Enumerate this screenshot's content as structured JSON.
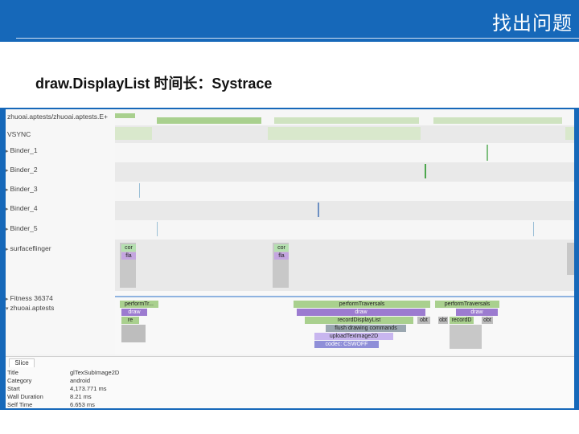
{
  "slide": {
    "title": "找出问题",
    "subtitle": "draw.DisplayList 时间长：Systrace",
    "accent": "#1668b9"
  },
  "threads": [
    {
      "label": "zhuoai.aptests/zhuoai.aptests.E+",
      "arrow": ""
    },
    {
      "label": "VSYNC",
      "arrow": ""
    },
    {
      "label": "Binder_1",
      "arrow": "▸"
    },
    {
      "label": "Binder_2",
      "arrow": "▸"
    },
    {
      "label": "Binder_3",
      "arrow": "▸"
    },
    {
      "label": "Binder_4",
      "arrow": "▸"
    },
    {
      "label": "Binder_5",
      "arrow": "▸"
    },
    {
      "label": "surfaceflinger",
      "arrow": "▸"
    },
    {
      "label": "Fitness 36374",
      "arrow": "▸"
    },
    {
      "label": "zhuoai.aptests",
      "arrow": "▾"
    }
  ],
  "slices": {
    "sf_a1": "cor",
    "sf_a2": "fla",
    "sf_b1": "cor",
    "sf_b2": "fla",
    "perf1": "performTr...",
    "draw1": "draw",
    "rec1": "re",
    "perf2": "performTraversals",
    "draw2": "draw",
    "rec2": "recordDisplayList",
    "flush": "flush drawing commands",
    "upload": "uploadTexImage2D",
    "texsub": "codec: CSWOFF",
    "obt1": "obt",
    "perf3": "performTraversals",
    "draw3": "draw",
    "rec3": "recordD",
    "obt2": "obt",
    "obt3": "obt"
  },
  "details": {
    "tab": "Slice",
    "rows": [
      {
        "key": "Title",
        "value": "glTexSubImage2D"
      },
      {
        "key": "Category",
        "value": "android"
      },
      {
        "key": "Start",
        "value": "4,173.771 ms"
      },
      {
        "key": "Wall Duration",
        "value": "8.21 ms"
      },
      {
        "key": "Self Time",
        "value": "6.653 ms"
      }
    ]
  },
  "colors": {
    "green": "#a9d08e",
    "purple": "#9c7bd0",
    "lavender": "#c8b6ef",
    "grey": "#c8c8c8",
    "blue": "#7fa7d9"
  }
}
